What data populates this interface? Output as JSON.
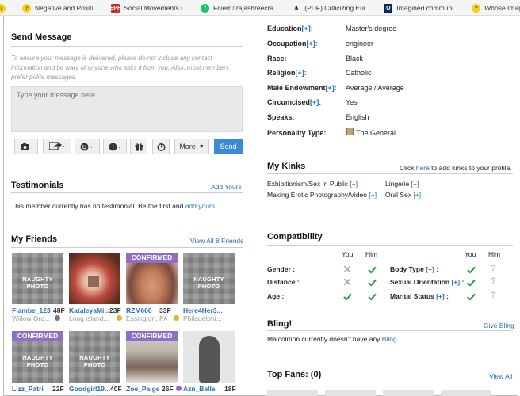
{
  "bookmarks": [
    {
      "icon": "?",
      "style": "fi-y",
      "name": "help-icon",
      "label": ""
    },
    {
      "icon": "?",
      "style": "fi-y",
      "name": "help-icon",
      "label": "Negative and Positi..."
    },
    {
      "icon": "EPH",
      "style": "fi-r",
      "name": "eph-logo-icon",
      "label": "Social Movements i..."
    },
    {
      "icon": "f",
      "style": "fi-g",
      "name": "fiverr-logo-icon",
      "label": "Fiverr / rajashreecra..."
    },
    {
      "icon": "A",
      "style": "fi-a",
      "name": "academia-logo-icon",
      "label": "(PDF) Criticizing Eur..."
    },
    {
      "icon": "O",
      "style": "fi-o",
      "name": "oxford-logo-icon",
      "label": "Imagined communi..."
    },
    {
      "icon": "?",
      "style": "fi-y",
      "name": "help-icon",
      "label": "Whose Imagined C..."
    }
  ],
  "send": {
    "title": "Send Message",
    "hint": "To ensure your message is delivered, please do not include any contact information and be wary of anyone who asks it from you. Also, most members prefer polite messages.",
    "placeholder": "Type your message here",
    "more": "More",
    "send": "Send"
  },
  "testimonials": {
    "title": "Testimonials",
    "add": "Add Yours",
    "text_pre": "This member currently has no testimonial. Be the first and ",
    "link": "add yours",
    "text_post": "."
  },
  "friends": {
    "title": "My Friends",
    "view_all": "View All 8 Friends",
    "items": [
      {
        "name": "Flambe_123",
        "age": "48F",
        "loc": "Willow Gro...",
        "badge": "NAUGHTY PHOTO",
        "conf": false,
        "dot": "d-g"
      },
      {
        "name": "KataleyaMi...",
        "age": "23F",
        "loc": "Long island...",
        "badge": "",
        "conf": false,
        "dot": "d-y"
      },
      {
        "name": "RZM666",
        "age": "33F",
        "loc": "Essington, PA",
        "badge": "",
        "conf": true,
        "dot": "d-y"
      },
      {
        "name": "Here4Her3...",
        "age": "",
        "loc": "Philadelphi...",
        "badge": "NAUGHTY PHOTO",
        "conf": false,
        "dot": ""
      },
      {
        "name": "Lizz_Patri",
        "age": "22F",
        "loc": "",
        "badge": "NAUGHTY PHOTO",
        "conf": true,
        "dot": ""
      },
      {
        "name": "Goodgirl19...",
        "age": "40F",
        "loc": "",
        "badge": "NAUGHTY PHOTO",
        "conf": false,
        "dot": ""
      },
      {
        "name": "Zoe_Paige",
        "age": "26F",
        "loc": "",
        "badge": "",
        "conf": true,
        "dot": "d-p"
      },
      {
        "name": "Azn_Belle",
        "age": "18F",
        "loc": "",
        "badge": "",
        "conf": false,
        "dot": ""
      }
    ]
  },
  "confirmed": "CONFIRMED",
  "profile": [
    {
      "label": "Education",
      "value": "Master's degree"
    },
    {
      "label": "Occupation",
      "value": "engineer"
    },
    {
      "label": "Race:",
      "value": "Black"
    },
    {
      "label": "Religion",
      "value": "Catholic"
    },
    {
      "label": "Male Endowment",
      "value": "Average / Average"
    },
    {
      "label": "Circumcised",
      "value": "Yes"
    },
    {
      "label": "Speaks:",
      "value": "English"
    },
    {
      "label": "Personality Type:",
      "value": "The General"
    }
  ],
  "plus": "[+]",
  "plus_colon": "[+]:",
  "kinks": {
    "title": "My Kinks",
    "click": "Click ",
    "here": "here",
    "to_add": " to add kinks to your profile.",
    "items": [
      "Exhibitionism/Sex In Public",
      "Making Erotic Photography/Video",
      "Lingerie",
      "Oral Sex"
    ]
  },
  "compat": {
    "title": "Compatibility",
    "you": "You",
    "him": "Him",
    "left": [
      "Gender :",
      "Distance :",
      "Age :"
    ],
    "right": [
      "Body Type",
      "Sexual Orientation",
      "Marital Status"
    ],
    "right_suffix": [
      " :",
      " :",
      " :"
    ]
  },
  "bling": {
    "title": "Bling!",
    "give": "Give Bling",
    "text": "Malcolmon currently doesn't have any ",
    "link": "Bling",
    "post": "."
  },
  "fans": {
    "title": "Top Fans: (0)",
    "view_all": "View All"
  },
  "colors": {
    "link": "#2a6ebb",
    "confirmed": "#8e6fc7",
    "send": "#3b8ad6",
    "check": "#2d9c3c",
    "cross": "#aaaaaa"
  }
}
